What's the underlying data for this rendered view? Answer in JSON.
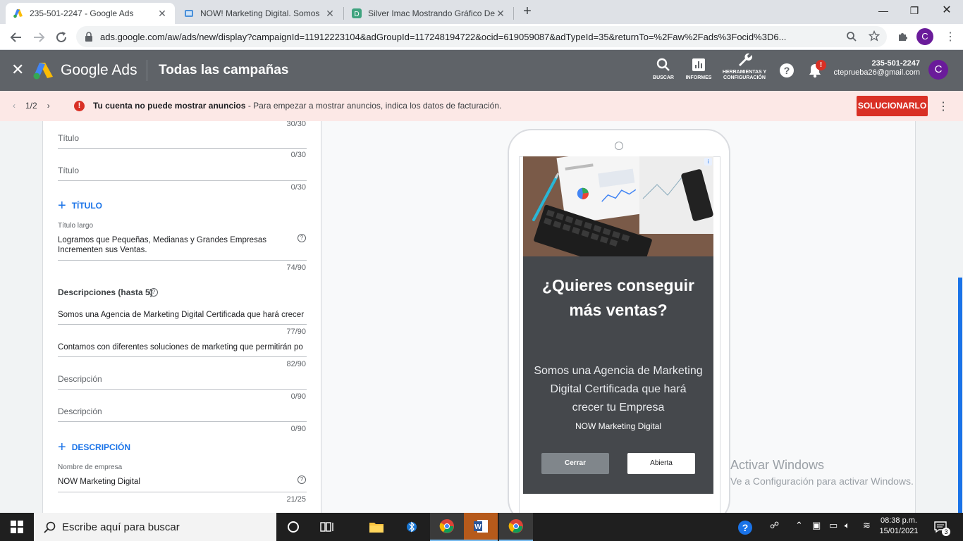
{
  "browser": {
    "tabs": [
      {
        "title": "235-501-2247 - Google Ads",
        "active": true
      },
      {
        "title": "NOW! Marketing Digital. Somos",
        "active": false
      },
      {
        "title": "Silver Imac Mostrando Gráfico De",
        "active": false
      }
    ],
    "url": "ads.google.com/aw/ads/new/display?campaignId=11912223104&adGroupId=117248194722&ocid=619059087&adTypeId=35&returnTo=%2Faw%2Fads%3Focid%3D6...",
    "profile_initial": "C"
  },
  "ads_header": {
    "brand": "Google Ads",
    "page_title": "Todas las campañas",
    "tools": {
      "search": "BUSCAR",
      "reports": "INFORMES",
      "settings": "HERRAMIENTAS Y CONFIGURACIÓN"
    },
    "account_number": "235-501-2247",
    "account_email": "cteprueba26@gmail.com",
    "avatar_initial": "C",
    "notification_badge": "!"
  },
  "notice": {
    "pager": "1/2",
    "bold": "Tu cuenta no puede mostrar anuncios",
    "text": " - Para empezar a mostrar anuncios, indica los datos de facturación.",
    "fix_button": "SOLUCIONARLO"
  },
  "form": {
    "top_count": "30/30",
    "headline_fields": [
      {
        "placeholder": "Título",
        "count": "0/30"
      },
      {
        "placeholder": "Título",
        "count": "0/30"
      }
    ],
    "add_headline": "TÍTULO",
    "long_headline": {
      "label": "Título largo",
      "value_line1": "Logramos que Pequeñas, Medianas y Grandes Empresas",
      "value_line2": "Incrementen sus Ventas.",
      "count": "74/90"
    },
    "descriptions_title": "Descripciones (hasta 5)",
    "descriptions": [
      {
        "value": "Somos una Agencia de Marketing Digital Certificada que hará crecer",
        "count": "77/90"
      },
      {
        "value": "Contamos con diferentes soluciones de marketing que permitirán po",
        "count": "82/90"
      }
    ],
    "empty_descriptions": [
      {
        "placeholder": "Descripción",
        "count": "0/90"
      },
      {
        "placeholder": "Descripción",
        "count": "0/90"
      }
    ],
    "add_description": "DESCRIPCIÓN",
    "business_name": {
      "label": "Nombre de empresa",
      "value": "NOW Marketing Digital",
      "count": "21/25"
    }
  },
  "preview": {
    "headline": "¿Quieres conseguir más ventas?",
    "description": "Somos una Agencia de Marketing Digital Certificada que hará crecer tu Empresa",
    "business_name": "NOW Marketing Digital",
    "close_button": "Cerrar",
    "open_button": "Abierta"
  },
  "watermark": {
    "line1": "Activar Windows",
    "line2": "Ve a Configuración para activar Windows."
  },
  "taskbar": {
    "search_placeholder": "Escribe aquí para buscar",
    "time": "08:38 p.m.",
    "date": "15/01/2021",
    "notifications_count": "3"
  }
}
